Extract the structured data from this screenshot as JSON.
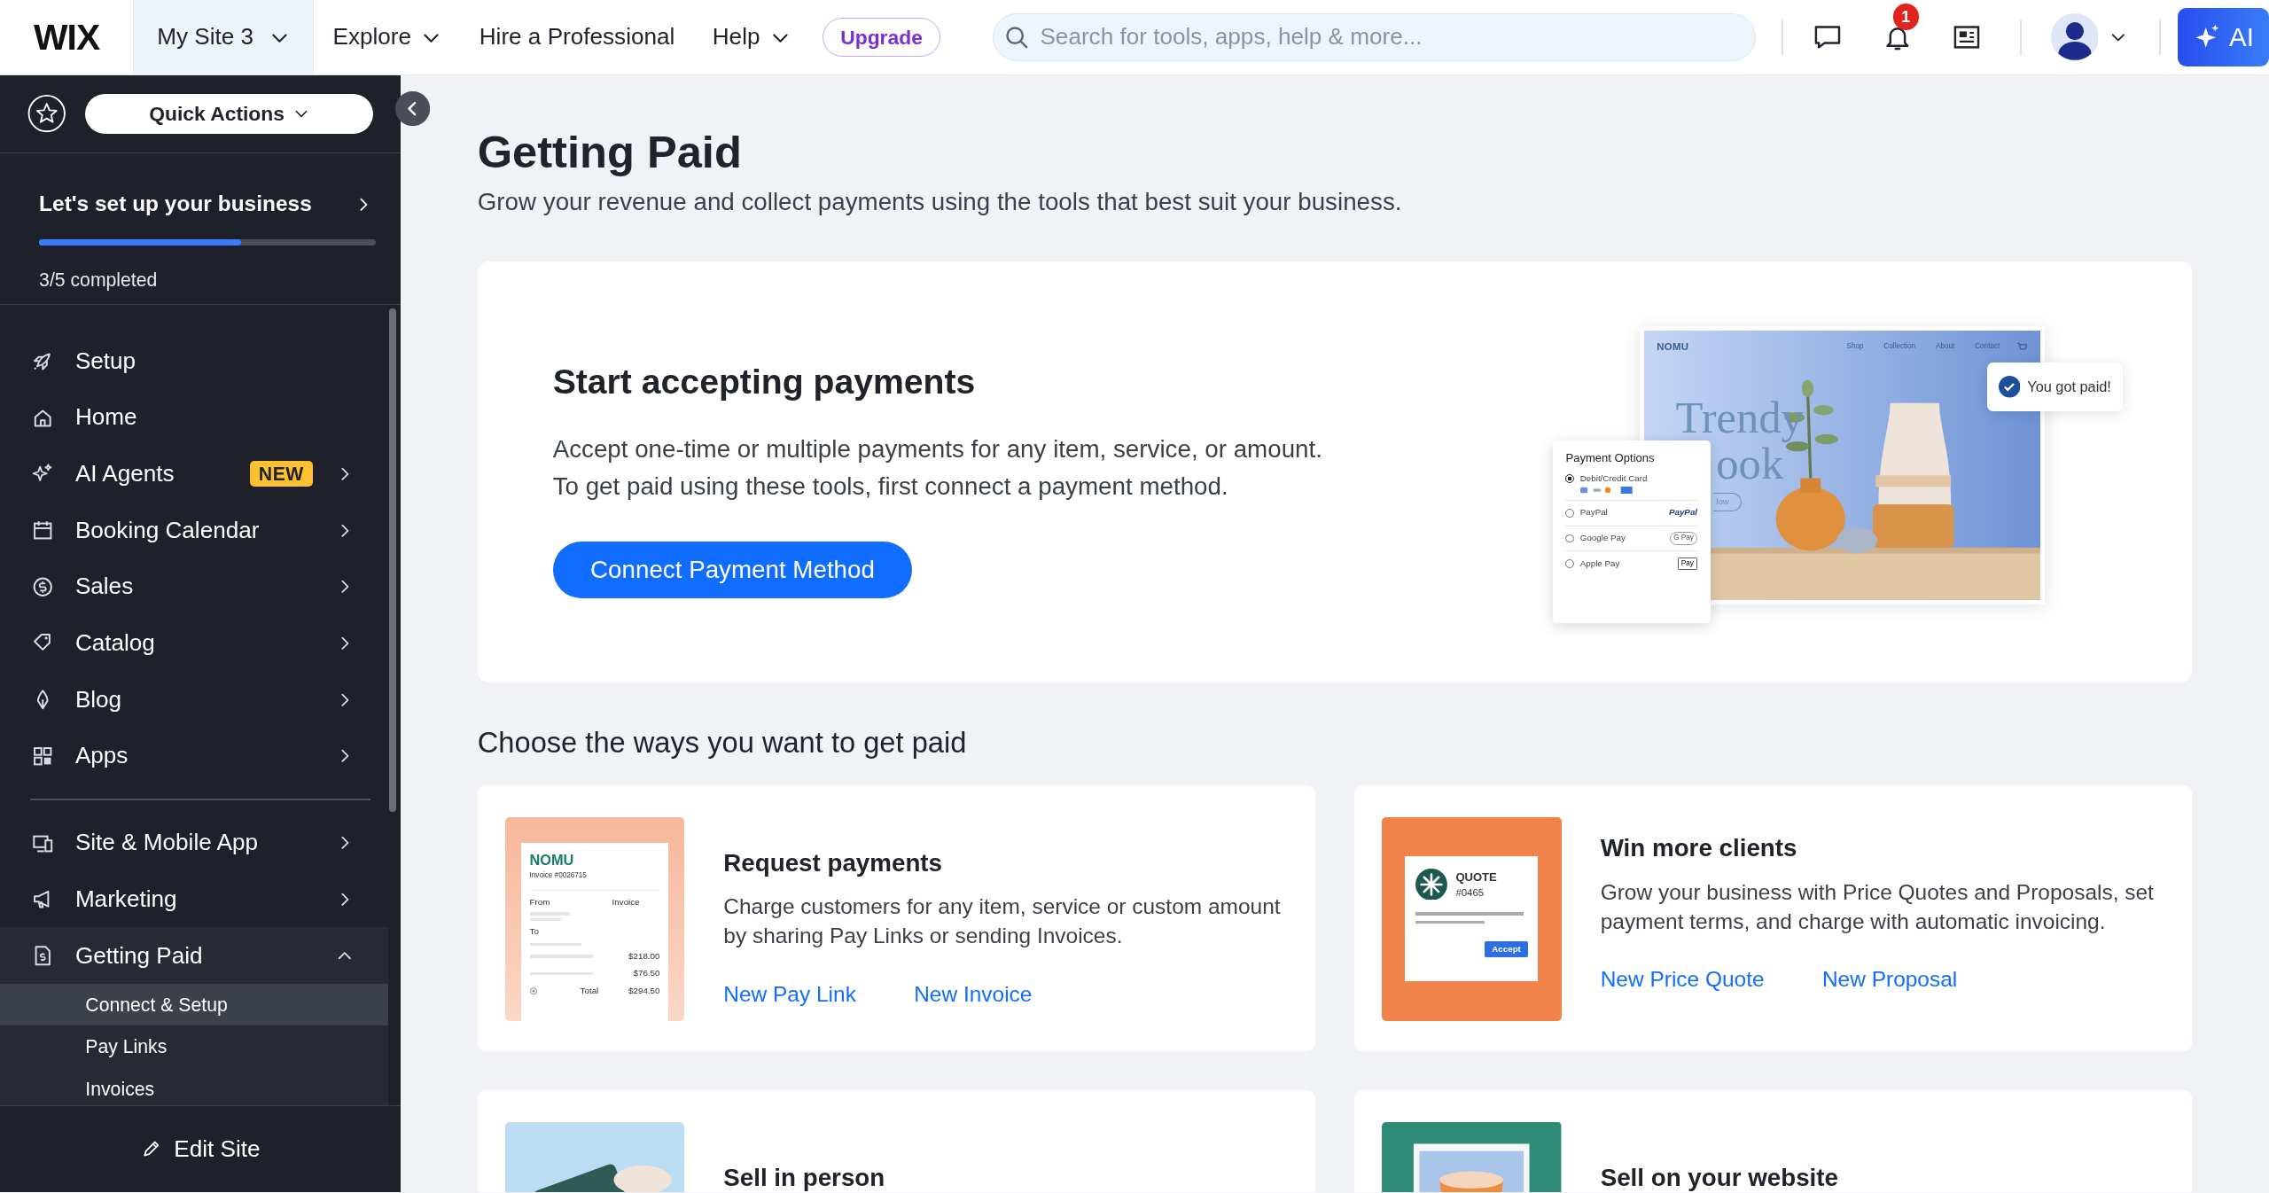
{
  "topbar": {
    "logo": "WIX",
    "site": "My Site 3",
    "menu": [
      {
        "label": "Explore",
        "dropdown": true
      },
      {
        "label": "Hire a Professional",
        "dropdown": false
      },
      {
        "label": "Help",
        "dropdown": true
      }
    ],
    "upgrade": "Upgrade",
    "search": {
      "placeholder": "Search for tools, apps, help & more..."
    },
    "notification_count": "1",
    "ai_button": "AI"
  },
  "sidebar": {
    "quick_actions": "Quick Actions",
    "setup": {
      "title": "Let's set up your business",
      "level": 0.6,
      "progress": "3/5 completed"
    },
    "items": [
      {
        "label": "Setup",
        "expandable": false
      },
      {
        "label": "Home",
        "expandable": false
      },
      {
        "label": "AI Agents",
        "badge": "NEW",
        "expandable": true
      },
      {
        "label": "Booking Calendar",
        "expandable": true
      },
      {
        "label": "Sales",
        "expandable": true
      },
      {
        "label": "Catalog",
        "expandable": true
      },
      {
        "label": "Blog",
        "expandable": true
      },
      {
        "label": "Apps",
        "expandable": true
      },
      {
        "kind": "divider"
      },
      {
        "label": "Site & Mobile App",
        "expandable": true
      },
      {
        "label": "Marketing",
        "expandable": true
      },
      {
        "label": "Getting Paid",
        "expandable": true,
        "expanded": true,
        "children": [
          {
            "label": "Connect & Setup",
            "selected": true
          },
          {
            "label": "Pay Links",
            "selected": false
          },
          {
            "label": "Invoices",
            "selected": false
          }
        ]
      }
    ],
    "footer": "Edit Site"
  },
  "page": {
    "title": "Getting Paid",
    "subtitle": "Grow your revenue and collect payments using the tools that best suit your business."
  },
  "hero": {
    "title": "Start accepting payments",
    "lines": [
      "Accept one-time or multiple payments for any item, service, or amount.",
      "To get paid using these tools, first connect a payment method."
    ],
    "button": "Connect Payment Method",
    "mockup": {
      "brand": "NOMU",
      "nav": [
        "Shop",
        "Collection",
        "About",
        "Contact"
      ],
      "headline": [
        "Trendy",
        "ook"
      ],
      "button": "low"
    },
    "payment_options": {
      "title": "Payment Options",
      "options": [
        {
          "label": "Debit/Credit Card",
          "selected": true
        },
        {
          "label": "PayPal",
          "selected": false,
          "logo": "PayPal"
        },
        {
          "label": "Google Pay",
          "selected": false,
          "logo": "G Pay"
        },
        {
          "label": "Apple Pay",
          "selected": false,
          "logo": "Pay"
        }
      ]
    },
    "toast": "You got paid!"
  },
  "section_title": "Choose the ways you want to get paid",
  "cards": [
    {
      "title": "Request payments",
      "description": "Charge customers for any item, service or custom amount by sharing Pay Links or sending Invoices.",
      "links": [
        "New Pay Link",
        "New Invoice"
      ],
      "thumbnail": {
        "kind": "invoice",
        "brand": "NOMU",
        "number": "Invoice #0026715",
        "from": "From",
        "invoice": "Invoice",
        "to": "To",
        "amounts": [
          "$218.00",
          "$76.50"
        ],
        "total_label": "Total",
        "total": "$294.50"
      }
    },
    {
      "title": "Win more clients",
      "description": "Grow your business with Price Quotes and Proposals, set payment terms, and charge with automatic invoicing.",
      "links": [
        "New Price Quote",
        "New Proposal"
      ],
      "thumbnail": {
        "kind": "quote",
        "title": "QUOTE",
        "number": "#0465",
        "button": "Accept"
      }
    },
    {
      "title": "Sell in person"
    },
    {
      "title": "Sell on your website"
    }
  ]
}
